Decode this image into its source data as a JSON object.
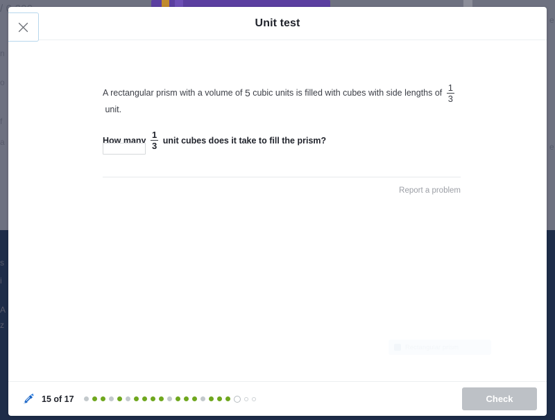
{
  "modal": {
    "title": "Unit test",
    "close_icon": "close-icon",
    "close_label": "Close"
  },
  "question": {
    "line1": [
      {
        "type": "text",
        "value": "A rectangular prism with a volume of "
      },
      {
        "type": "big",
        "value": "5"
      },
      {
        "type": "text",
        "value": " cubic units is filled with cubes with side lengths of "
      },
      {
        "type": "frac",
        "num": "1",
        "den": "3"
      },
      {
        "type": "text",
        "value": " unit."
      }
    ],
    "line2": [
      {
        "type": "text",
        "value": "How many "
      },
      {
        "type": "frac",
        "num": "1",
        "den": "3"
      },
      {
        "type": "text",
        "value": " unit cubes does it take to fill the prism?"
      }
    ],
    "answer_value": "",
    "answer_placeholder": ""
  },
  "report": {
    "label": "Report a problem"
  },
  "footer": {
    "streak_icon": "pencil-icon",
    "progress_text": "15 of 17",
    "check_label": "Check",
    "check_disabled": true,
    "dots": [
      "incorrect",
      "correct",
      "correct",
      "incorrect",
      "correct",
      "incorrect",
      "correct",
      "correct",
      "correct",
      "correct",
      "incorrect",
      "correct",
      "correct",
      "correct",
      "incorrect",
      "correct",
      "correct",
      "correct",
      "current",
      "upcoming",
      "upcoming"
    ]
  },
  "background": {
    "ghost_number": "/ 0.200",
    "ghost_a": "n",
    "ghost_b": "o",
    "ghost_c": "f",
    "ghost_d": "a",
    "ghost_e": "s",
    "ghost_f": "i",
    "ghost_g": "A",
    "ghost_h": "z",
    "ghost_right_1": "e",
    "ghost_right_2": "e",
    "ghost_widget_text": "Rectangular prism"
  },
  "colors": {
    "correct": "#6fa71e",
    "incorrect": "#c3c9cc",
    "accent_blue": "#1b67c8",
    "overlay": "#6e7180",
    "navy": "#1e2d49",
    "purple": "#5b3fa0",
    "disabled_button": "#bdc1c6"
  }
}
